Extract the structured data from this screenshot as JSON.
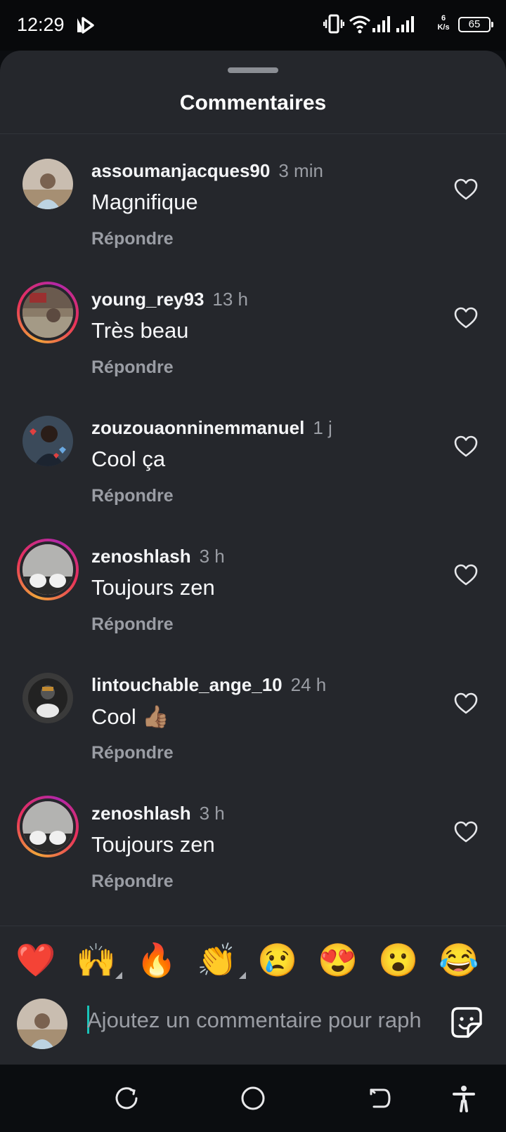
{
  "status_bar": {
    "time": "12:29",
    "net_speed_value": "6",
    "net_speed_unit": "K/s",
    "battery": "65"
  },
  "sheet": {
    "title": "Commentaires"
  },
  "comments": [
    {
      "username": "assoumanjacques90",
      "time": "3 min",
      "text": "Magnifique",
      "reply": "Répondre",
      "story_ring": false
    },
    {
      "username": "young_rey93",
      "time": "13 h",
      "text": "Très beau",
      "reply": "Répondre",
      "story_ring": true
    },
    {
      "username": "zouzouaonninemmanuel",
      "time": "1 j",
      "text": "Cool ça",
      "reply": "Répondre",
      "story_ring": false
    },
    {
      "username": "zenoshlash",
      "time": "3 h",
      "text": "Toujours zen",
      "reply": "Répondre",
      "story_ring": true
    },
    {
      "username": "lintouchable_ange_10",
      "time": "24 h",
      "text": "Cool 👍🏽",
      "reply": "Répondre",
      "story_ring": false
    },
    {
      "username": "zenoshlash",
      "time": "3 h",
      "text": "Toujours zen",
      "reply": "Répondre",
      "story_ring": true
    }
  ],
  "quick_reactions": [
    "❤️",
    "🙌",
    "🔥",
    "👏",
    "😢",
    "😍",
    "😮",
    "😂"
  ],
  "composer": {
    "placeholder": "Ajoutez un commentaire pour raph",
    "value": ""
  },
  "colors": {
    "sheet_bg": "#25272c",
    "background": "#0b0d10",
    "secondary_text": "#9a9da4",
    "cursor": "#19c3b8",
    "story_ring": [
      "#f0a43a",
      "#e8305a",
      "#b227a8"
    ]
  },
  "icons": {
    "status": [
      "media-play-icon",
      "vibrate-icon",
      "wifi-icon",
      "signal-icon",
      "battery-icon"
    ],
    "comment": [
      "heart-outline-icon"
    ],
    "composer": [
      "sticker-icon"
    ],
    "nav": [
      "recents-icon",
      "home-icon",
      "back-icon",
      "accessibility-icon"
    ]
  }
}
